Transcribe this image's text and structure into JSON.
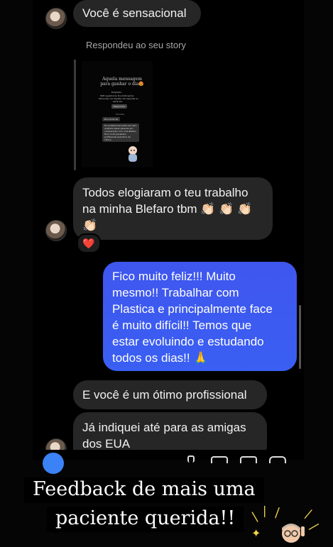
{
  "messages": {
    "m1": "Você é sensacional",
    "reply_note": "Respondeu ao seu story",
    "m2_line1": "Todos elogiaram o teu trabalho",
    "m2_line2": "na minha Blefaro tbm 👏🏻 👏🏻 👏🏻",
    "m2_line3": "👏🏻",
    "reaction": "❤️",
    "out_lines": [
      "Fico muito feliz!!! Muito",
      "mesmo!! Trabalhar com",
      "Plastica e principalmente face",
      "é muito difícil!! Temos que",
      "estar evoluindo e estudando",
      "todos os dias!! 🙏"
    ],
    "m3": "E você é um ótimo profissional",
    "m4_line1": "Já indiquei até para as amigas",
    "m4_line2": "dos EUA"
  },
  "story": {
    "title": "Aquela mensagem para ganhar o dia😍",
    "line_a": "Pergunte",
    "line_b": "SIM seguidores ☺ a Indicações",
    "line_c": "Deixe-me ver alguém em especial se",
    "line_d": "seria um",
    "btn": "Responder",
    "label": "Escolha",
    "reply1": "Boa tarde bb",
    "reply2": "Fui profissional nesta vez bem avaliado pelas pessoas em comparação com uma Blefaro ficou lindo parabéns profissional pela face da clínica"
  },
  "caption": {
    "line1": "Feedback de mais uma",
    "line2": "paciente querida!!"
  },
  "colors": {
    "incoming": "#262626",
    "outgoing": "#3b5cf0",
    "background": "#000000"
  }
}
